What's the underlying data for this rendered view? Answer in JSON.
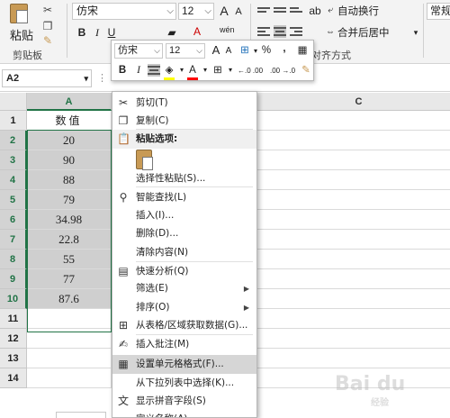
{
  "ribbon": {
    "clipboard": {
      "paste_label": "粘贴",
      "group_label": "剪贴板"
    },
    "font": {
      "name": "仿宋",
      "size": "12",
      "grow": "A",
      "shrink": "A",
      "bold": "B",
      "italic": "I",
      "underline": "U",
      "phonetic": "wén"
    },
    "alignment": {
      "wrap_text": "自动换行",
      "merge_center": "合并后居中",
      "group_label": "对齐方式"
    },
    "number": {
      "format": "常规"
    }
  },
  "formula_bar": {
    "name_box": "A2",
    "dots": "⋮"
  },
  "columns": [
    "A",
    "B",
    "C"
  ],
  "rows": [
    "1",
    "2",
    "3",
    "4",
    "5",
    "6",
    "7",
    "8",
    "9",
    "10",
    "11",
    "12",
    "13",
    "14"
  ],
  "cells": {
    "A1": "数值",
    "A2": "20",
    "A3": "90",
    "A4": "88",
    "A5": "79",
    "A6": "34.98",
    "A7": "22.8",
    "A8": "55",
    "A9": "77",
    "A10": "87.6"
  },
  "mini_toolbar": {
    "font": "仿宋",
    "size": "12",
    "grow": "A",
    "shrink": "A",
    "percent": "%",
    "comma": ",",
    "bold": "B",
    "italic": "I",
    "font_color_letter": "A",
    "dec_inc": "←.0 .00",
    "dec_dec": ".00 →.0"
  },
  "context_menu": {
    "items": [
      {
        "label": "剪切(T)",
        "icon": "scissors-icon"
      },
      {
        "label": "复制(C)",
        "icon": "copy-icon"
      },
      {
        "label": "粘贴选项:",
        "icon": "paste-icon"
      },
      {
        "label": "选择性粘贴(S)...",
        "icon": ""
      },
      {
        "label": "智能查找(L)",
        "icon": "search-icon"
      },
      {
        "label": "插入(I)...",
        "icon": ""
      },
      {
        "label": "删除(D)...",
        "icon": ""
      },
      {
        "label": "清除内容(N)",
        "icon": ""
      },
      {
        "label": "快速分析(Q)",
        "icon": "quick-analysis-icon"
      },
      {
        "label": "筛选(E)",
        "icon": "",
        "submenu": true
      },
      {
        "label": "排序(O)",
        "icon": "",
        "submenu": true
      },
      {
        "label": "从表格/区域获取数据(G)...",
        "icon": "table-icon"
      },
      {
        "label": "插入批注(M)",
        "icon": "comment-icon"
      },
      {
        "label": "设置单元格格式(F)...",
        "icon": "format-cells-icon",
        "highlighted": true
      },
      {
        "label": "从下拉列表中选择(K)...",
        "icon": ""
      },
      {
        "label": "显示拼音字段(S)",
        "icon": "phonetic-icon"
      },
      {
        "label": "定义名称(A)...",
        "icon": ""
      }
    ]
  },
  "watermark": {
    "brand": "Bai du",
    "sub": "经验"
  },
  "colors": {
    "accent_green": "#217346",
    "highlight": "#d6d6d6",
    "fill_yellow": "#ffff00",
    "font_red": "#ff0000"
  }
}
